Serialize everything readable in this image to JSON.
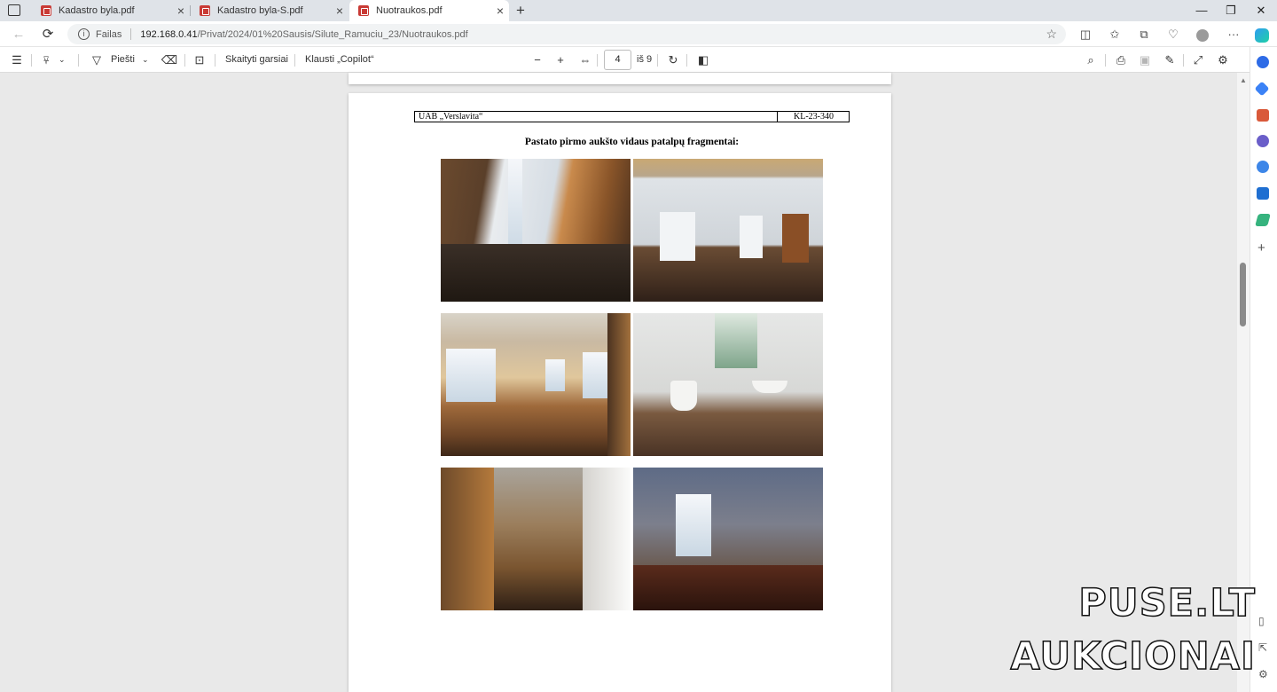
{
  "tabs": [
    {
      "label": "Kadastro byla.pdf",
      "active": false
    },
    {
      "label": "Kadastro byla-S.pdf",
      "active": false
    },
    {
      "label": "Nuotraukos.pdf",
      "active": true
    }
  ],
  "new_tab_label": "+",
  "address": {
    "scheme_label": "Failas",
    "host": "192.168.0.41",
    "path": "/Privat/2024/01%20Sausis/Silute_Ramuciu_23/Nuotraukos.pdf"
  },
  "pdf_toolbar": {
    "draw_label": "Piešti",
    "read_aloud_label": "Skaityti garsiai",
    "copilot_label": "Klausti „Copilot“",
    "page_number": "4",
    "page_total_label": "iš 9"
  },
  "document": {
    "header_company": "UAB „Verslavita“",
    "header_code": "KL-23-340",
    "section_title": "Pastato pirmo aukšto vidaus patalpų fragmentai:",
    "photos": [
      {
        "name": "entrance-hallway-photo"
      },
      {
        "name": "room-with-open-doors-photo"
      },
      {
        "name": "sunlit-hall-photo"
      },
      {
        "name": "restroom-photo"
      },
      {
        "name": "corridor-photo"
      },
      {
        "name": "dark-room-photo"
      }
    ]
  },
  "watermark": {
    "line1": "PUSE.LT",
    "line2": "AUKCIONAI"
  },
  "colors": {
    "pdf_icon": "#c93a35",
    "tabbar_bg": "#dfe3e8",
    "viewer_bg": "#e9e9e9"
  }
}
